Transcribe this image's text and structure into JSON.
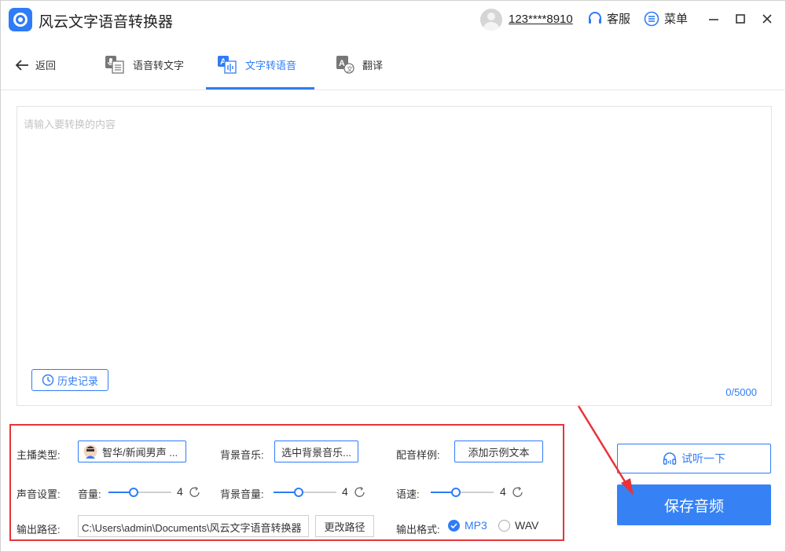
{
  "app": {
    "title": "风云文字语音转换器"
  },
  "header": {
    "phone": "123****8910",
    "service_label": "客服",
    "menu_label": "菜单"
  },
  "nav": {
    "back_label": "返回",
    "tabs": [
      {
        "label": "语音转文字",
        "icon": "microphone-doc-icon",
        "active": false
      },
      {
        "label": "文字转语音",
        "icon": "text-to-audio-icon",
        "active": true
      },
      {
        "label": "翻译",
        "icon": "translate-icon",
        "active": false
      }
    ]
  },
  "editor": {
    "placeholder": "请输入要转换的内容",
    "value": "",
    "history_label": "历史记录",
    "counter": "0/5000"
  },
  "settings": {
    "anchor_type_label": "主播类型:",
    "anchor_value": "智华/新闻男声 ...",
    "bg_music_label": "背景音乐:",
    "bg_music_button": "选中背景音乐...",
    "sample_label": "配音样例:",
    "sample_button": "添加示例文本",
    "sound_settings_label": "声音设置:",
    "volume_label": "音量:",
    "volume_value": "4",
    "volume_level": 0.4,
    "bg_volume_label": "背景音量:",
    "bg_volume_value": "4",
    "bg_volume_level": 0.4,
    "speed_label": "语速:",
    "speed_value": "4",
    "speed_level": 0.4,
    "output_path_label": "输出路径:",
    "output_path": "C:\\Users\\admin\\Documents\\风云文字语音转换器",
    "change_path_button": "更改路径",
    "output_format_label": "输出格式:",
    "formats": [
      {
        "label": "MP3",
        "selected": true
      },
      {
        "label": "WAV",
        "selected": false
      }
    ]
  },
  "actions": {
    "listen_label": "试听一下",
    "save_label": "保存音频"
  },
  "colors": {
    "accent": "#2f7cf6",
    "highlight": "#e8333a",
    "save_bg": "#3682f4"
  }
}
